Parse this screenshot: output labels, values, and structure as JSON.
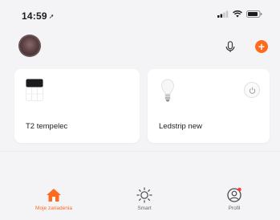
{
  "status_bar": {
    "time": "14:59",
    "location_glyph": "➚"
  },
  "header": {
    "avatar_icon": "avatar",
    "mic_icon": "microphone-icon",
    "add_icon": "plus-icon",
    "add_glyph": "+"
  },
  "devices": [
    {
      "name": "T2 tempelec",
      "icon": "thermostat-icon"
    },
    {
      "name": "Ledstrip new",
      "icon": "bulb-icon",
      "has_power_button": true
    }
  ],
  "tabbar": {
    "items": [
      {
        "label": "Moje zariadenia",
        "icon": "home-icon",
        "active": true
      },
      {
        "label": "Smart",
        "icon": "sun-icon",
        "active": false
      },
      {
        "label": "Profil",
        "icon": "profile-icon",
        "active": false
      }
    ]
  },
  "colors": {
    "accent": "#ff6a1f",
    "background": "#f4f4f6",
    "card": "#ffffff"
  }
}
